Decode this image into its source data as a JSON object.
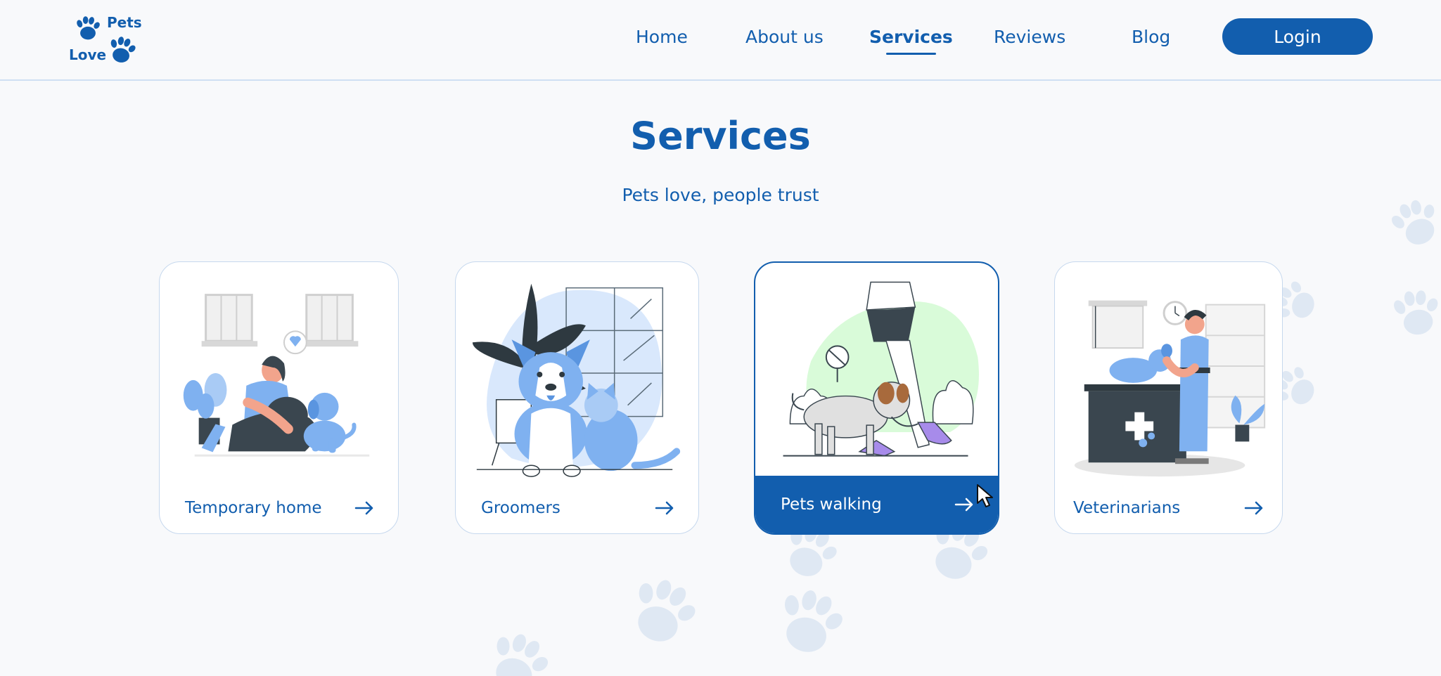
{
  "logo": {
    "line1": "Pets",
    "line2": "Love",
    "icon": "paw-icon"
  },
  "nav": {
    "items": [
      {
        "label": "Home",
        "active": false
      },
      {
        "label": "About us",
        "active": false
      },
      {
        "label": "Services",
        "active": true
      },
      {
        "label": "Reviews",
        "active": false
      },
      {
        "label": "Blog",
        "active": false
      }
    ],
    "login_label": "Login"
  },
  "main": {
    "title": "Services",
    "subtitle": "Pets love, people trust",
    "cards": [
      {
        "label": "Temporary home",
        "icon": "arrow-right-icon",
        "illustration": "woman-with-dog-illustration"
      },
      {
        "label": "Groomers",
        "icon": "arrow-right-icon",
        "illustration": "corgi-and-cat-illustration"
      },
      {
        "label": "Pets walking",
        "icon": "arrow-right-icon",
        "illustration": "dog-walking-illustration",
        "active": true
      },
      {
        "label": "Veterinarians",
        "icon": "arrow-right-icon",
        "illustration": "vet-with-dog-illustration"
      }
    ]
  },
  "colors": {
    "brand": "#125eae",
    "background": "#f8f9fb",
    "illustration_blue": "#7fb1f0",
    "illustration_green": "#d9fbd9",
    "illustration_dark": "#3a464f",
    "paw_bg": "#dfe8f3"
  }
}
